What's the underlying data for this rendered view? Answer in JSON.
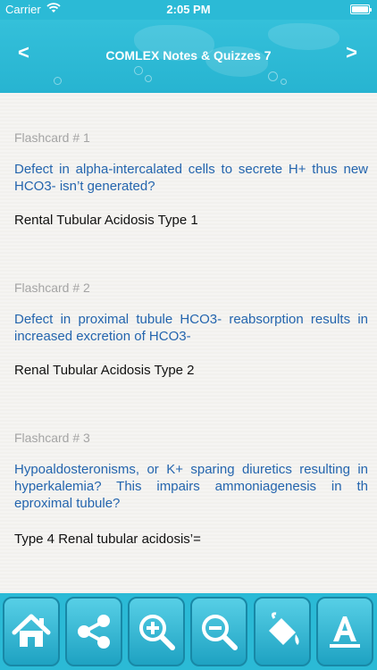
{
  "status_bar": {
    "carrier": "Carrier",
    "time": "2:05 PM"
  },
  "nav": {
    "title": "COMLEX Notes & Quizzes 7",
    "back_label": "<",
    "forward_label": ">"
  },
  "cards": [
    {
      "label": "Flashcard # 1",
      "question": "Defect in alpha-intercalated cells to secrete H+ thus new HCO3- isn’t generated?",
      "answer": "Rental Tubular Acidosis Type 1"
    },
    {
      "label": "Flashcard # 2",
      "question": "Defect in proximal tubule HCO3- reabsorption results in increased excretion of HCO3-",
      "answer": "Renal Tubular Acidosis Type 2"
    },
    {
      "label": "Flashcard # 3",
      "question": "Hypoaldosteronisms, or K+ sparing diuretics resulting in hyperkalemia? This impairs ammoniagenesis in th eproximal tubule?",
      "answer": "Type 4 Renal tubular acidosis’="
    }
  ],
  "toolbar": {
    "icons": [
      "home-icon",
      "share-icon",
      "zoom-in-icon",
      "zoom-out-icon",
      "paint-bucket-icon",
      "font-icon"
    ]
  },
  "colors": {
    "accent": "#2bbad6",
    "question_text": "#2465ae",
    "label_text": "#a4a4a4"
  }
}
